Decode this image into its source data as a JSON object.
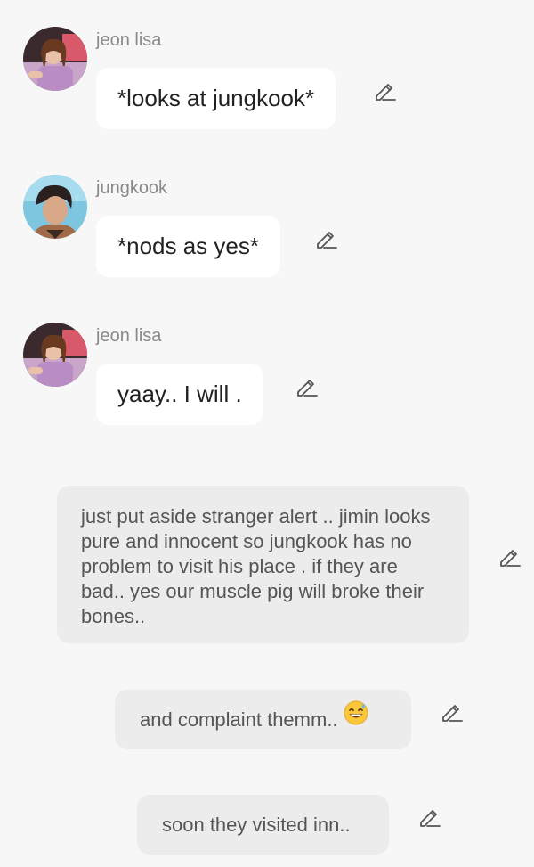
{
  "messages": [
    {
      "sender": "jeon lisa",
      "text": "*looks at jungkook*",
      "avatar": "lisa-avatar"
    },
    {
      "sender": "jungkook",
      "text": "*nods as yes*",
      "avatar": "jungkook-avatar"
    },
    {
      "sender": "jeon lisa",
      "text": "yaay.. I will .",
      "avatar": "lisa-avatar"
    }
  ],
  "narration": [
    {
      "text": "just put aside stranger alert .. jimin looks pure and innocent so jungkook has no problem to visit his place . if they are bad.. yes our muscle pig will broke their bones.."
    },
    {
      "text": "and complaint themm..",
      "emoji": "😅"
    },
    {
      "text": "soon they visited inn.."
    }
  ],
  "icons": {
    "edit": "pencil-edit-icon",
    "emoji": "grinning-face-with-sweat-emoji"
  },
  "colors": {
    "background": "#f7f7f7",
    "user_bubble": "#ffffff",
    "narration_bubble": "#ececec",
    "sender_name": "#8a8a8a",
    "icon": "#555555"
  }
}
